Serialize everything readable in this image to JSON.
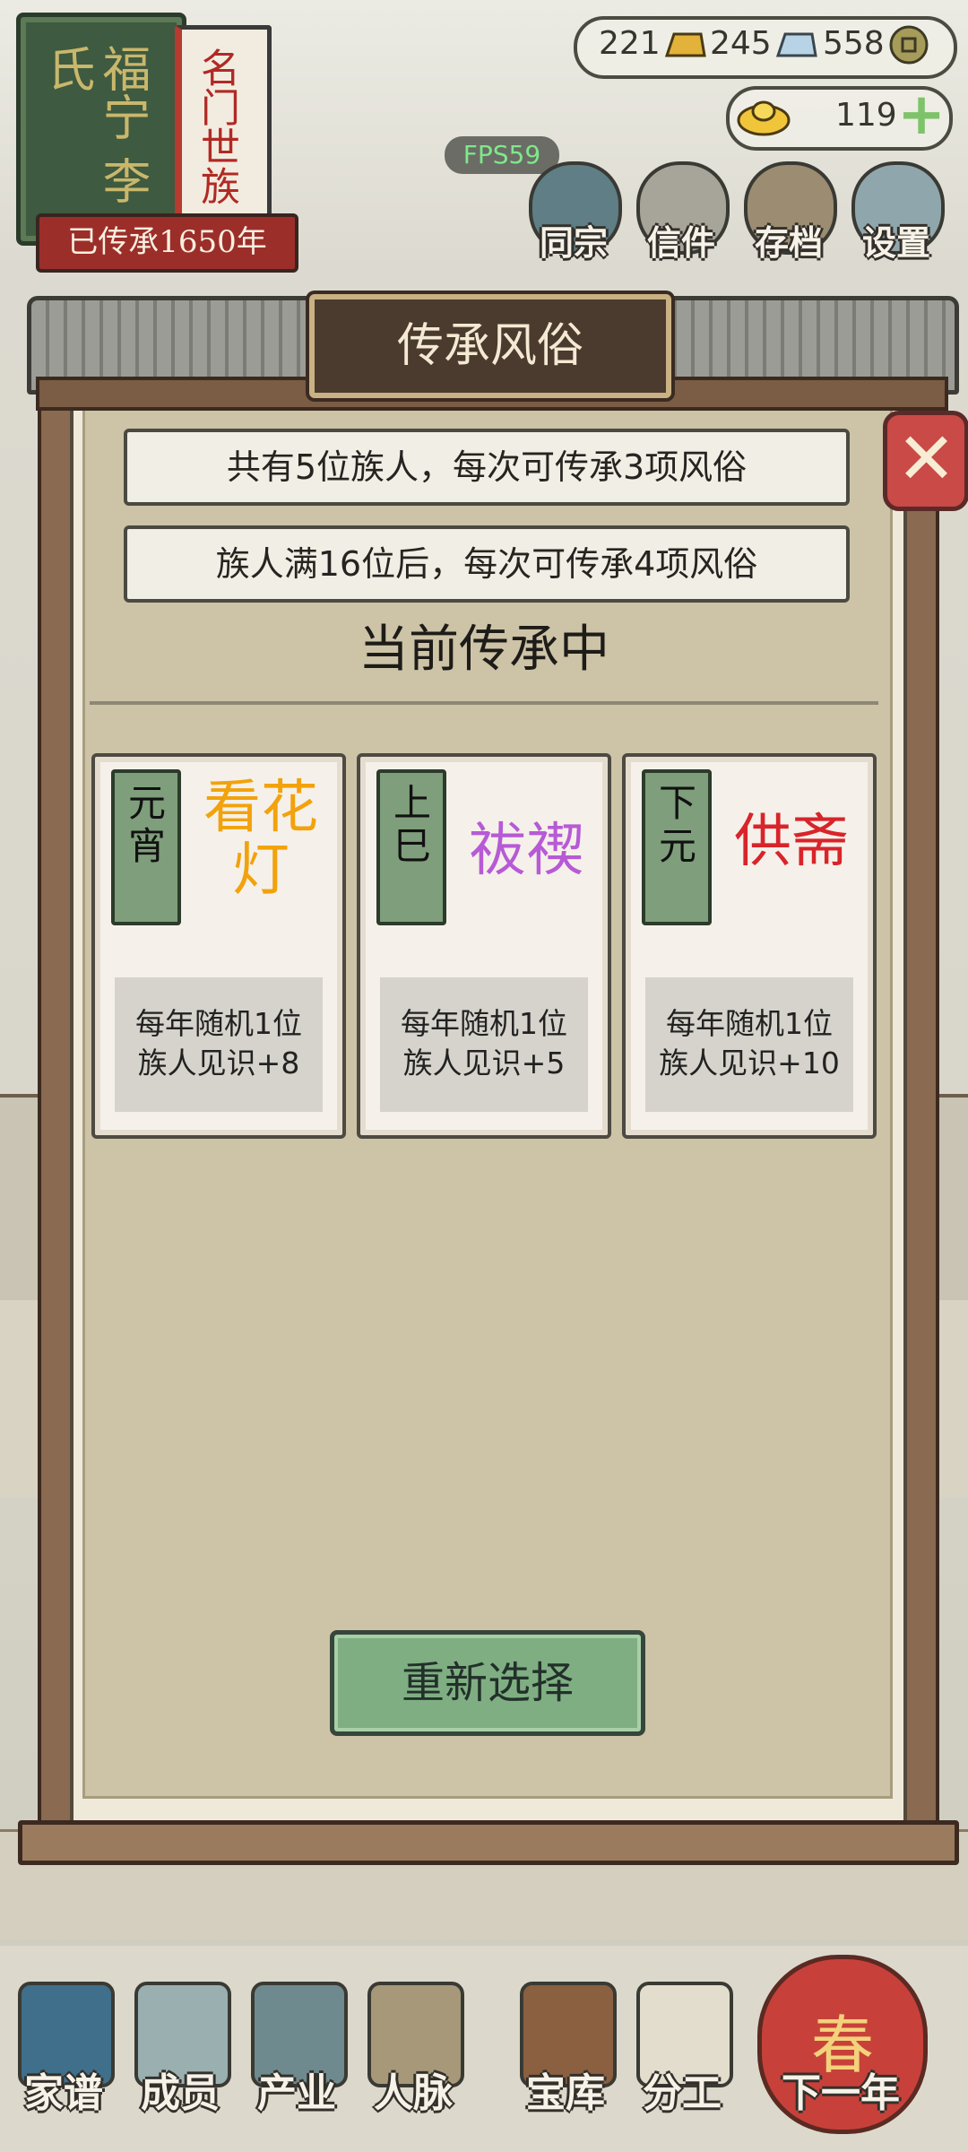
{
  "header": {
    "banner_family": "福宁 李氏",
    "banner_title": "名门世族",
    "inheritance_years": "已传承1650年",
    "fps": "FPS59"
  },
  "resources": {
    "gold_bars": "221",
    "silver_bars": "245",
    "coins": "558",
    "ingots": "119"
  },
  "top_menu": [
    {
      "label": "同宗",
      "icon": "book-icon"
    },
    {
      "label": "信件",
      "icon": "letter-icon"
    },
    {
      "label": "存档",
      "icon": "scroll-icon"
    },
    {
      "label": "设置",
      "icon": "gear-icon"
    }
  ],
  "modal": {
    "title": "传承风俗",
    "info_line_1": "共有5位族人，每次可传承3项风俗",
    "info_line_2": "族人满16位后，每次可传承4项风俗",
    "section_title": "当前传承中",
    "reselect_label": "重新选择",
    "close_label": "✕"
  },
  "cards": [
    {
      "festival": "元宵",
      "custom": "看花灯",
      "custom_color": "#f2a20c",
      "desc_line_1": "每年随机1位",
      "desc_line_2": "族人见识+8"
    },
    {
      "festival": "上巳",
      "custom": "祓禊",
      "custom_color": "#b75ad6",
      "desc_line_1": "每年随机1位",
      "desc_line_2": "族人见识+5"
    },
    {
      "festival": "下元",
      "custom": "供斋",
      "custom_color": "#d8242a",
      "desc_line_1": "每年随机1位",
      "desc_line_2": "族人见识+10"
    }
  ],
  "bottom_nav": [
    {
      "label": "家谱",
      "icon": "family-tree-icon"
    },
    {
      "label": "成员",
      "icon": "member-icon"
    },
    {
      "label": "产业",
      "icon": "building-icon"
    },
    {
      "label": "人脉",
      "icon": "network-icon"
    },
    {
      "label": "宝库",
      "icon": "treasure-chest-icon"
    },
    {
      "label": "分工",
      "icon": "scroll-icon"
    },
    {
      "label": "下一年",
      "icon": "lantern-icon"
    }
  ],
  "season_char": "春",
  "colors": {
    "accent_green": "#7fae82",
    "close_red": "#c94a46",
    "plaque_brown": "#4b3a2e"
  }
}
